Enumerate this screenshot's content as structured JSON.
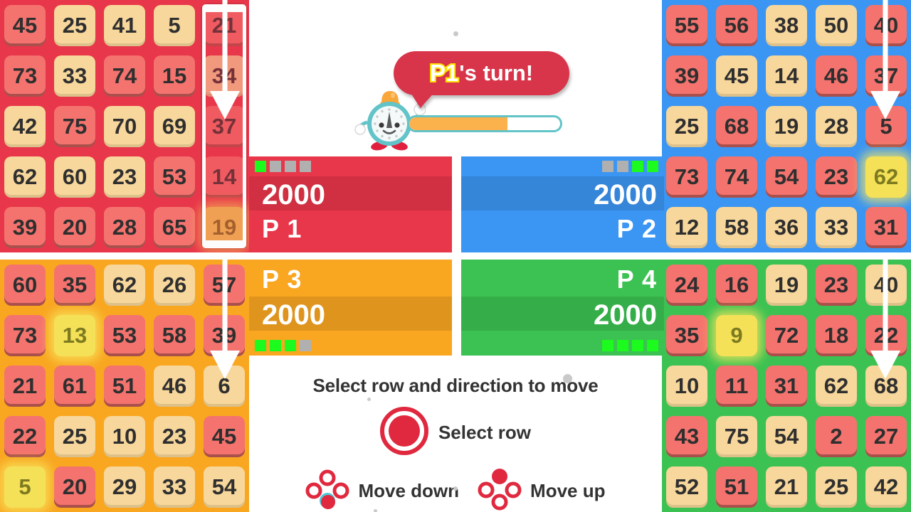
{
  "turn": {
    "player": "P1",
    "suffix": "'s turn!",
    "timer_percent": 65,
    "mascot_icon": "alarm-clock-mascot-icon"
  },
  "players": [
    {
      "id": "p1",
      "name": "P 1",
      "score": "2000",
      "color": "#e8364a",
      "pips": [
        "on",
        "off",
        "off",
        "off"
      ]
    },
    {
      "id": "p2",
      "name": "P 2",
      "score": "2000",
      "color": "#3b95f2",
      "pips": [
        "off",
        "off",
        "on",
        "on"
      ]
    },
    {
      "id": "p3",
      "name": "P 3",
      "score": "2000",
      "color": "#f9a621",
      "pips": [
        "on",
        "on",
        "on",
        "off"
      ]
    },
    {
      "id": "p4",
      "name": "P 4",
      "score": "2000",
      "color": "#3cc252",
      "pips": [
        "on",
        "on",
        "on",
        "on"
      ]
    }
  ],
  "boards": {
    "p1": {
      "bg": "#e8364a",
      "rows": [
        [
          {
            "v": "45",
            "t": "red"
          },
          {
            "v": "25",
            "t": "cream"
          },
          {
            "v": "41",
            "t": "cream"
          },
          {
            "v": "5",
            "t": "cream"
          },
          {
            "v": "21",
            "t": "red"
          }
        ],
        [
          {
            "v": "73",
            "t": "red"
          },
          {
            "v": "33",
            "t": "cream"
          },
          {
            "v": "74",
            "t": "red"
          },
          {
            "v": "15",
            "t": "red"
          },
          {
            "v": "34",
            "t": "cream"
          }
        ],
        [
          {
            "v": "42",
            "t": "cream"
          },
          {
            "v": "75",
            "t": "red"
          },
          {
            "v": "70",
            "t": "cream"
          },
          {
            "v": "69",
            "t": "cream"
          },
          {
            "v": "37",
            "t": "red"
          }
        ],
        [
          {
            "v": "62",
            "t": "cream"
          },
          {
            "v": "60",
            "t": "cream"
          },
          {
            "v": "23",
            "t": "cream"
          },
          {
            "v": "53",
            "t": "red"
          },
          {
            "v": "14",
            "t": "red"
          }
        ],
        [
          {
            "v": "39",
            "t": "red"
          },
          {
            "v": "20",
            "t": "red"
          },
          {
            "v": "28",
            "t": "red"
          },
          {
            "v": "65",
            "t": "red"
          },
          {
            "v": "19",
            "t": "gold"
          }
        ]
      ],
      "selected_column": 4,
      "arrow": {
        "column": 4,
        "direction": "down",
        "tip_row": 2
      }
    },
    "p2": {
      "bg": "#3b95f2",
      "rows": [
        [
          {
            "v": "55",
            "t": "red"
          },
          {
            "v": "56",
            "t": "red"
          },
          {
            "v": "38",
            "t": "cream"
          },
          {
            "v": "50",
            "t": "cream"
          },
          {
            "v": "40",
            "t": "red"
          }
        ],
        [
          {
            "v": "39",
            "t": "red"
          },
          {
            "v": "45",
            "t": "cream"
          },
          {
            "v": "14",
            "t": "cream"
          },
          {
            "v": "46",
            "t": "red"
          },
          {
            "v": "37",
            "t": "red"
          }
        ],
        [
          {
            "v": "25",
            "t": "cream"
          },
          {
            "v": "68",
            "t": "red"
          },
          {
            "v": "19",
            "t": "cream"
          },
          {
            "v": "28",
            "t": "cream"
          },
          {
            "v": "5",
            "t": "red"
          }
        ],
        [
          {
            "v": "73",
            "t": "red"
          },
          {
            "v": "74",
            "t": "red"
          },
          {
            "v": "54",
            "t": "red"
          },
          {
            "v": "23",
            "t": "red"
          },
          {
            "v": "62",
            "t": "gold"
          }
        ],
        [
          {
            "v": "12",
            "t": "cream"
          },
          {
            "v": "58",
            "t": "cream"
          },
          {
            "v": "36",
            "t": "cream"
          },
          {
            "v": "33",
            "t": "cream"
          },
          {
            "v": "31",
            "t": "red"
          }
        ]
      ],
      "selected_column": null,
      "arrow": {
        "column": 4,
        "direction": "down",
        "tip_row": 2
      }
    },
    "p3": {
      "bg": "#f9a621",
      "rows": [
        [
          {
            "v": "60",
            "t": "red"
          },
          {
            "v": "35",
            "t": "red"
          },
          {
            "v": "62",
            "t": "cream"
          },
          {
            "v": "26",
            "t": "cream"
          },
          {
            "v": "57",
            "t": "red"
          }
        ],
        [
          {
            "v": "73",
            "t": "red"
          },
          {
            "v": "13",
            "t": "gold"
          },
          {
            "v": "53",
            "t": "red"
          },
          {
            "v": "58",
            "t": "red"
          },
          {
            "v": "39",
            "t": "red"
          }
        ],
        [
          {
            "v": "21",
            "t": "red"
          },
          {
            "v": "61",
            "t": "red"
          },
          {
            "v": "51",
            "t": "red"
          },
          {
            "v": "46",
            "t": "cream"
          },
          {
            "v": "6",
            "t": "cream"
          }
        ],
        [
          {
            "v": "22",
            "t": "red"
          },
          {
            "v": "25",
            "t": "cream"
          },
          {
            "v": "10",
            "t": "cream"
          },
          {
            "v": "23",
            "t": "cream"
          },
          {
            "v": "45",
            "t": "red"
          }
        ],
        [
          {
            "v": "5",
            "t": "gold"
          },
          {
            "v": "20",
            "t": "red"
          },
          {
            "v": "29",
            "t": "cream"
          },
          {
            "v": "33",
            "t": "cream"
          },
          {
            "v": "54",
            "t": "cream"
          }
        ]
      ],
      "selected_column": null,
      "arrow": {
        "column": 4,
        "direction": "down",
        "tip_row": 2
      }
    },
    "p4": {
      "bg": "#3cc252",
      "rows": [
        [
          {
            "v": "24",
            "t": "red"
          },
          {
            "v": "16",
            "t": "red"
          },
          {
            "v": "19",
            "t": "cream"
          },
          {
            "v": "23",
            "t": "red"
          },
          {
            "v": "40",
            "t": "cream"
          }
        ],
        [
          {
            "v": "35",
            "t": "red"
          },
          {
            "v": "9",
            "t": "gold"
          },
          {
            "v": "72",
            "t": "red"
          },
          {
            "v": "18",
            "t": "red"
          },
          {
            "v": "22",
            "t": "red"
          }
        ],
        [
          {
            "v": "10",
            "t": "cream"
          },
          {
            "v": "11",
            "t": "red"
          },
          {
            "v": "31",
            "t": "red"
          },
          {
            "v": "62",
            "t": "cream"
          },
          {
            "v": "68",
            "t": "cream"
          }
        ],
        [
          {
            "v": "43",
            "t": "red"
          },
          {
            "v": "75",
            "t": "cream"
          },
          {
            "v": "54",
            "t": "cream"
          },
          {
            "v": "2",
            "t": "red"
          },
          {
            "v": "27",
            "t": "red"
          }
        ],
        [
          {
            "v": "52",
            "t": "cream"
          },
          {
            "v": "51",
            "t": "red"
          },
          {
            "v": "21",
            "t": "cream"
          },
          {
            "v": "25",
            "t": "cream"
          },
          {
            "v": "42",
            "t": "cream"
          }
        ]
      ],
      "selected_column": null,
      "arrow": {
        "column": 4,
        "direction": "down",
        "tip_row": 2
      }
    }
  },
  "help": {
    "title": "Select row and direction to move",
    "select_row_label": "Select row",
    "move_down_label": "Move down",
    "move_up_label": "Move up"
  },
  "colors": {
    "tile_red": "#f4736e",
    "tile_cream": "#f7d79b",
    "tile_gold": "#f4e158",
    "pip_on": "#1dfa1d",
    "pip_off": "#b0b0b0",
    "bubble": "#d8354a",
    "timer_fill": "#fbb14c"
  }
}
